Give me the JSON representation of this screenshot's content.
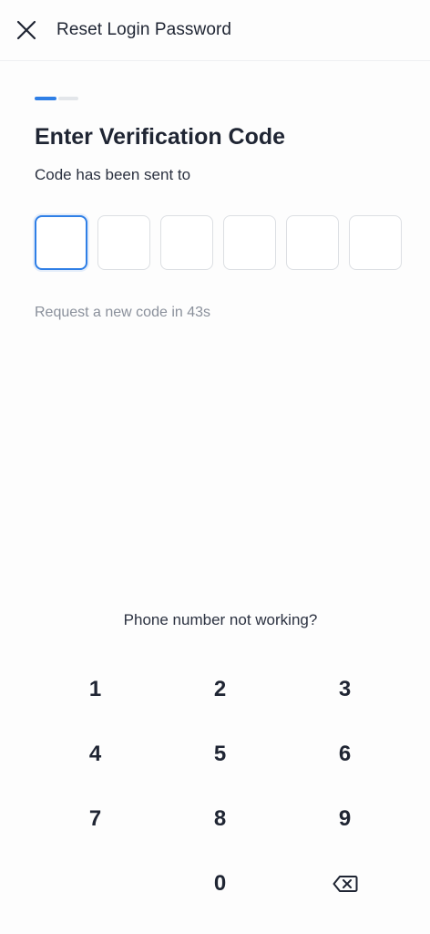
{
  "header": {
    "title": "Reset Login Password",
    "close_icon": "close-icon"
  },
  "progress": {
    "step": 1,
    "total": 2,
    "active_color": "#2f7fe6"
  },
  "main": {
    "title": "Enter Verification Code",
    "sent_text": "Code has been sent to",
    "code_length": 6,
    "code_value": "",
    "resend_text": "Request a new code in 43s"
  },
  "help_link": "Phone number not working?",
  "keypad": {
    "keys": [
      "1",
      "2",
      "3",
      "4",
      "5",
      "6",
      "7",
      "8",
      "9",
      "",
      "0",
      "backspace-icon"
    ]
  }
}
